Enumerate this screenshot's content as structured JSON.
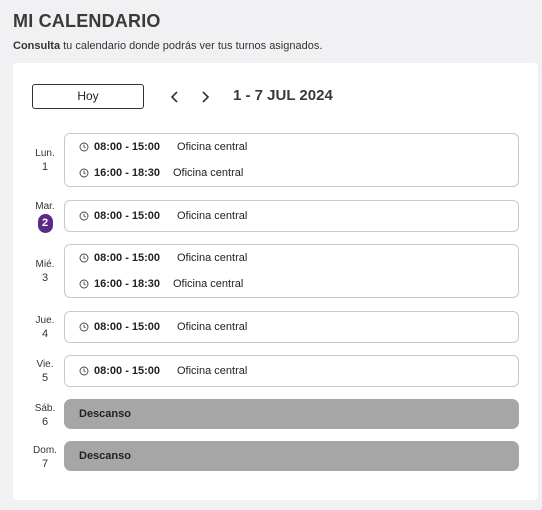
{
  "header": {
    "title": "MI CALENDARIO",
    "subtitle_bold": "Consulta",
    "subtitle_rest": " tu calendario donde podrás ver tus turnos asignados."
  },
  "toolbar": {
    "today_label": "Hoy",
    "prev_icon": "chevron-left-icon",
    "next_icon": "chevron-right-icon",
    "range": "1 - 7 JUL 2024"
  },
  "colors": {
    "accent": "#5b2a86",
    "rest": "#a6a6a6"
  },
  "days": [
    {
      "abbr": "Lun.",
      "num": "1",
      "today": false,
      "shifts": [
        {
          "time": "08:00 - 15:00",
          "place": "Oficina central"
        },
        {
          "time": "16:00 - 18:30",
          "place": "Oficina central"
        }
      ]
    },
    {
      "abbr": "Mar.",
      "num": "2",
      "today": true,
      "shifts": [
        {
          "time": "08:00 - 15:00",
          "place": "Oficina central"
        }
      ]
    },
    {
      "abbr": "Mié.",
      "num": "3",
      "today": false,
      "shifts": [
        {
          "time": "08:00 - 15:00",
          "place": "Oficina central"
        },
        {
          "time": "16:00 - 18:30",
          "place": "Oficina central"
        }
      ]
    },
    {
      "abbr": "Jue.",
      "num": "4",
      "today": false,
      "shifts": [
        {
          "time": "08:00 - 15:00",
          "place": "Oficina central"
        }
      ]
    },
    {
      "abbr": "Vie.",
      "num": "5",
      "today": false,
      "shifts": [
        {
          "time": "08:00 - 15:00",
          "place": "Oficina central"
        }
      ]
    },
    {
      "abbr": "Sáb.",
      "num": "6",
      "today": false,
      "rest": "Descanso"
    },
    {
      "abbr": "Dom.",
      "num": "7",
      "today": false,
      "rest": "Descanso"
    }
  ]
}
